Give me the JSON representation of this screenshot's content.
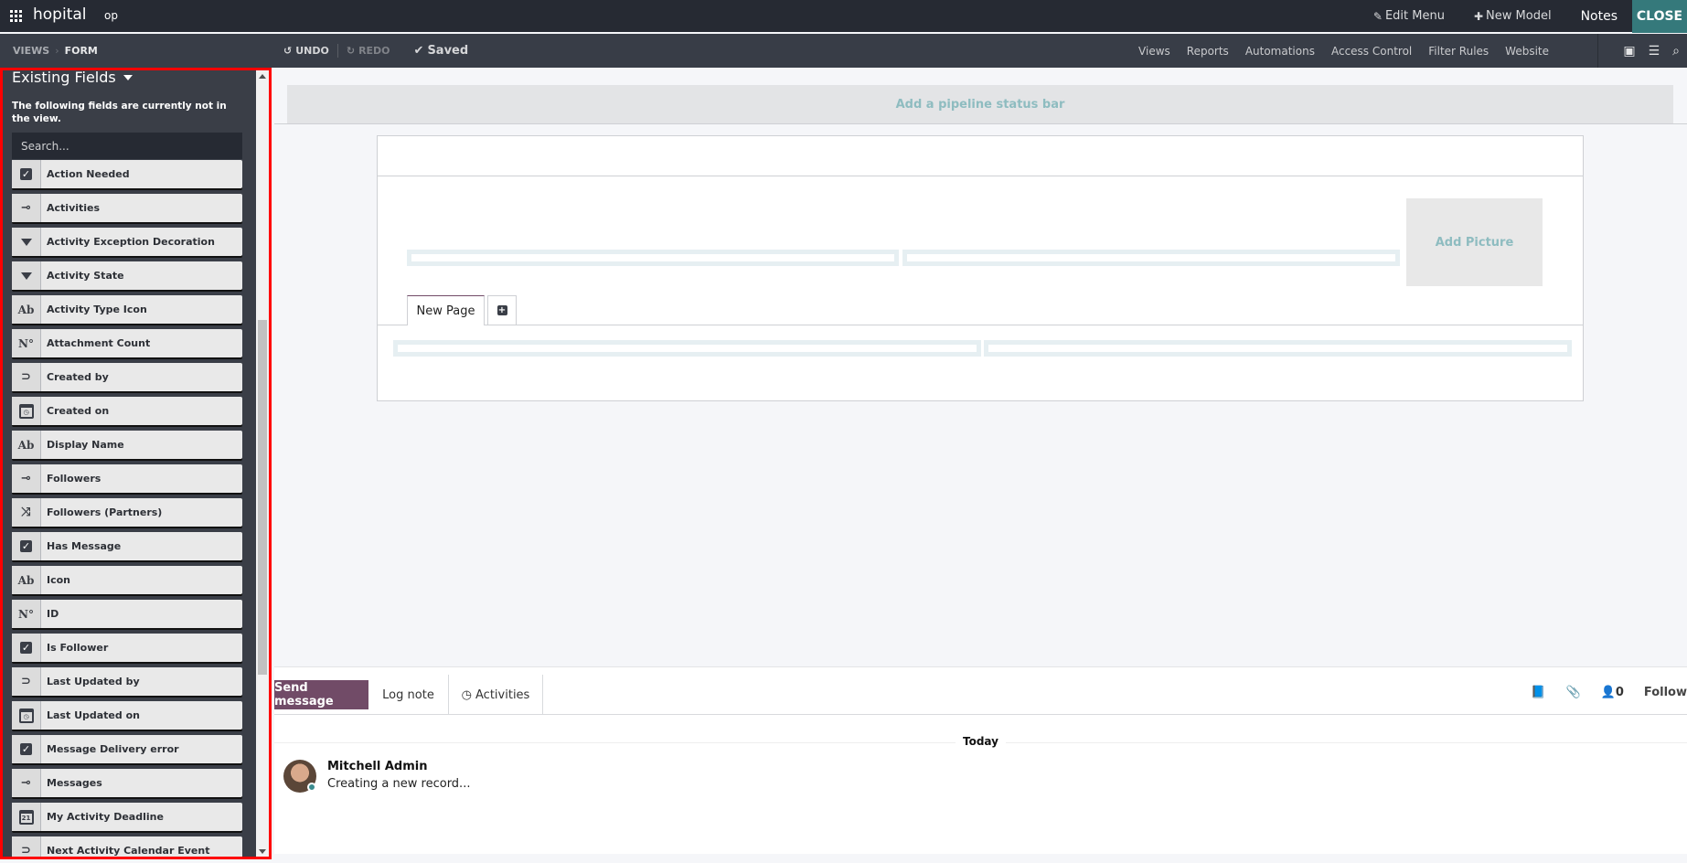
{
  "topbar": {
    "app_title": "hopital",
    "menu_item": "op",
    "edit_menu": "Edit Menu",
    "new_model": "New Model",
    "notes": "Notes",
    "close": "CLOSE"
  },
  "subbar": {
    "breadcrumb": [
      "VIEWS",
      "FORM"
    ],
    "undo": "UNDO",
    "redo": "REDO",
    "saved": "Saved",
    "links": [
      "Views",
      "Reports",
      "Automations",
      "Access Control",
      "Filter Rules",
      "Website"
    ]
  },
  "sidebar": {
    "title": "Existing Fields",
    "description": "The following fields are currently not in the view.",
    "search_placeholder": "Search...",
    "fields": [
      {
        "label": "Action Needed",
        "icon": "checkbox-icon"
      },
      {
        "label": "Activities",
        "icon": "one2many-icon"
      },
      {
        "label": "Activity Exception Decoration",
        "icon": "selection-icon"
      },
      {
        "label": "Activity State",
        "icon": "selection-icon"
      },
      {
        "label": "Activity Type Icon",
        "icon": "text-icon"
      },
      {
        "label": "Attachment Count",
        "icon": "integer-icon"
      },
      {
        "label": "Created by",
        "icon": "many2one-icon"
      },
      {
        "label": "Created on",
        "icon": "datetime-icon"
      },
      {
        "label": "Display Name",
        "icon": "text-icon"
      },
      {
        "label": "Followers",
        "icon": "one2many-icon"
      },
      {
        "label": "Followers (Partners)",
        "icon": "many2many-icon"
      },
      {
        "label": "Has Message",
        "icon": "checkbox-icon"
      },
      {
        "label": "Icon",
        "icon": "text-icon"
      },
      {
        "label": "ID",
        "icon": "integer-icon"
      },
      {
        "label": "Is Follower",
        "icon": "checkbox-icon"
      },
      {
        "label": "Last Updated by",
        "icon": "many2one-icon"
      },
      {
        "label": "Last Updated on",
        "icon": "datetime-icon"
      },
      {
        "label": "Message Delivery error",
        "icon": "checkbox-icon"
      },
      {
        "label": "Messages",
        "icon": "one2many-icon"
      },
      {
        "label": "My Activity Deadline",
        "icon": "date-icon"
      },
      {
        "label": "Next Activity Calendar Event",
        "icon": "many2one-icon"
      }
    ]
  },
  "form": {
    "pipeline_hint": "Add a pipeline status bar",
    "add_picture": "Add Picture",
    "tab_label": "New Page"
  },
  "chatter": {
    "send_message": "Send message",
    "log_note": "Log note",
    "activities": "Activities",
    "follower_count": "0",
    "follow": "Follow",
    "date_separator": "Today",
    "message": {
      "author": "Mitchell Admin",
      "body": "Creating a new record..."
    }
  },
  "colors": {
    "brand": "#714b67",
    "close_button": "#35797b",
    "highlight_border": "#ff0000"
  }
}
